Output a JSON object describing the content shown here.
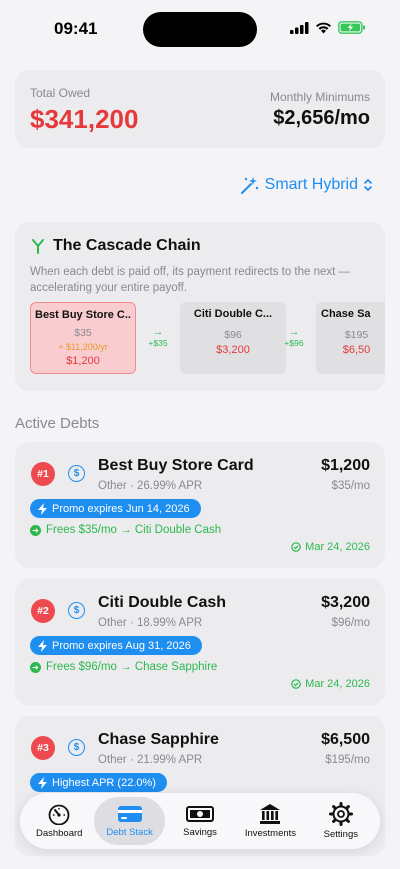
{
  "status": {
    "time": "09:41"
  },
  "summary": {
    "total_label": "Total Owed",
    "total_value": "$341,200",
    "minimums_label": "Monthly Minimums",
    "minimums_value": "$2,656/mo"
  },
  "strategy": {
    "label": "Smart Hybrid"
  },
  "cascade": {
    "title": "The Cascade Chain",
    "description": "When each debt is paid off, its payment redirects to the next — accelerating your entire payoff.",
    "nodes": [
      {
        "name": "Best Buy Store C...",
        "min": "$35",
        "extra": "+ $11,200/yr",
        "balance": "$1,200"
      },
      {
        "name": "Citi Double C...",
        "min": "$96",
        "balance": "$3,200"
      },
      {
        "name": "Chase Sa",
        "min": "$195",
        "balance": "$6,50"
      }
    ],
    "arrows": [
      "+$35",
      "+$96"
    ]
  },
  "section": {
    "active_debts": "Active Debts"
  },
  "debts": [
    {
      "rank": "#1",
      "name": "Best Buy Store Card",
      "meta": "Other  ·  26.99% APR",
      "balance": "$1,200",
      "min": "$35/mo",
      "promo": "Promo expires Jun 14, 2026",
      "frees": "Frees $35/mo → Citi Double Cash",
      "date": "Mar 24, 2026"
    },
    {
      "rank": "#2",
      "name": "Citi Double Cash",
      "meta": "Other  ·  18.99% APR",
      "balance": "$3,200",
      "min": "$96/mo",
      "promo": "Promo expires Aug 31, 2026",
      "frees": "Frees $96/mo → Chase Sapphire",
      "date": "Mar 24, 2026"
    },
    {
      "rank": "#3",
      "name": "Chase Sapphire",
      "meta": "Other  ·  21.99% APR",
      "balance": "$6,500",
      "min": "$195/mo",
      "promo": "Highest APR (22.0%)"
    }
  ],
  "tabs": [
    {
      "label": "Dashboard",
      "icon": "gauge-icon"
    },
    {
      "label": "Debt Stack",
      "icon": "credit-card-icon",
      "selected": true
    },
    {
      "label": "Savings",
      "icon": "banknote-icon"
    },
    {
      "label": "Investments",
      "icon": "bank-icon"
    },
    {
      "label": "Settings",
      "icon": "gear-icon"
    }
  ],
  "colors": {
    "accent": "#1e8ef0",
    "danger": "#e5393a",
    "success": "#2db84d",
    "warning": "#e89a2a"
  }
}
